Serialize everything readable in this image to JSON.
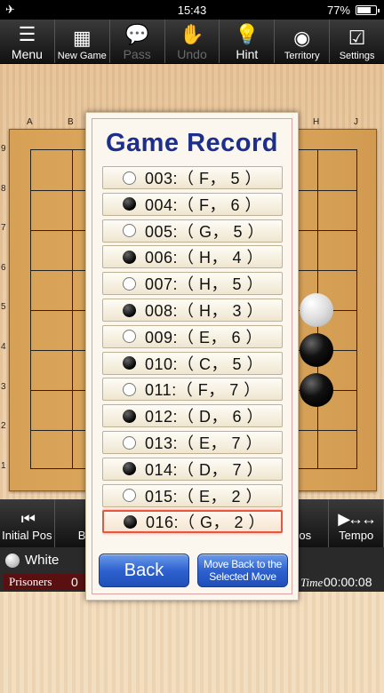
{
  "status": {
    "airplane_icon": "airplane-icon",
    "time": "15:43",
    "battery": "77%",
    "battery_level": 0.77
  },
  "toolbar": [
    {
      "label": "Menu",
      "icon": "menu-icon",
      "glyph": "☰",
      "enabled": true
    },
    {
      "label": "New Game",
      "icon": "grid-icon",
      "glyph": "▦",
      "enabled": true
    },
    {
      "label": "Pass",
      "icon": "speech-bubble-icon",
      "glyph": "💬",
      "enabled": false
    },
    {
      "label": "Undo",
      "icon": "hand-icon",
      "glyph": "✋",
      "enabled": false
    },
    {
      "label": "Hint",
      "icon": "lightbulb-icon",
      "glyph": "💡",
      "enabled": true
    },
    {
      "label": "Territory",
      "icon": "shapes-icon",
      "glyph": "◉",
      "enabled": true
    },
    {
      "label": "Settings",
      "icon": "checkbox-icon",
      "glyph": "☑",
      "enabled": true
    }
  ],
  "board": {
    "columns": [
      "A",
      "B",
      "",
      "",
      "",
      "",
      "",
      "H",
      "J"
    ],
    "rows": [
      "9",
      "8",
      "7",
      "6",
      "5",
      "4",
      "3",
      "2",
      "1"
    ]
  },
  "navbar": [
    {
      "label": "Initial Pos",
      "icon": "skip-to-start-icon",
      "glyph": "⏮"
    },
    {
      "label": "B",
      "icon": "step-back-icon",
      "glyph": ""
    },
    {
      "label": "",
      "icon": "",
      "glyph": ""
    },
    {
      "label": "",
      "icon": "",
      "glyph": ""
    },
    {
      "label": "",
      "icon": "",
      "glyph": ""
    },
    {
      "label": "Pos",
      "icon": "",
      "glyph": ""
    },
    {
      "label": "Tempo",
      "icon": "play-tempo-icon",
      "glyph": "▶↔↔"
    }
  ],
  "info": {
    "player": "White",
    "prisoners_label": "Prisoners",
    "prisoners_count": "0",
    "time_label": "Time",
    "time_value": "00:00:08"
  },
  "modal": {
    "title": "Game Record",
    "records": [
      {
        "color": "white",
        "text": "003:（ F， 5 ）"
      },
      {
        "color": "black",
        "text": "004:（ F， 6 ）"
      },
      {
        "color": "white",
        "text": "005:（ G， 5 ）"
      },
      {
        "color": "black",
        "text": "006:（ H， 4 ）"
      },
      {
        "color": "white",
        "text": "007:（ H， 5 ）"
      },
      {
        "color": "black",
        "text": "008:（ H， 3 ）"
      },
      {
        "color": "white",
        "text": "009:（ E， 6 ）"
      },
      {
        "color": "black",
        "text": "010:（ C， 5 ）"
      },
      {
        "color": "white",
        "text": "011:（ F， 7 ）"
      },
      {
        "color": "black",
        "text": "012:（ D， 6 ）"
      },
      {
        "color": "white",
        "text": "013:（ E， 7 ）"
      },
      {
        "color": "black",
        "text": "014:（ D， 7 ）"
      },
      {
        "color": "white",
        "text": "015:（ E， 2 ）"
      },
      {
        "color": "black",
        "text": "016:（ G， 2 ）",
        "selected": true
      }
    ],
    "back_label": "Back",
    "move_back_label": "Move Back to the Selected Move"
  }
}
